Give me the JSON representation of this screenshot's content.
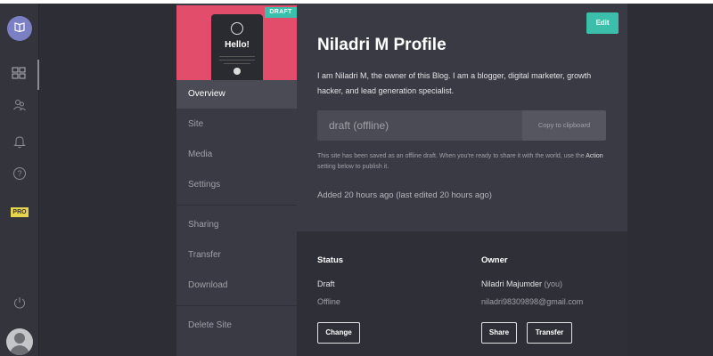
{
  "thumbnail": {
    "greeting": "Hello!",
    "badge": "DRAFT"
  },
  "nav": {
    "items": [
      "Overview",
      "Site",
      "Media",
      "Settings",
      "Sharing",
      "Transfer",
      "Download",
      "Delete Site"
    ]
  },
  "rail": {
    "pro_label": "PRO"
  },
  "site": {
    "title": "Niladri M Profile",
    "description": "I am Niladri M, the owner of this Blog. I am a blogger, digital marketer, growth hacker, and lead generation specialist.",
    "url": "draft (offline)",
    "copy_label": "Copy to clipboard",
    "note_before": "This site has been saved as an offline draft. When you're ready to share it with the world, use the",
    "note_action": "Action",
    "note_after": "setting below to publish it.",
    "added": "Added 20 hours ago (last edited 20 hours ago)",
    "edit_label": "Edit"
  },
  "status": {
    "heading": "Status",
    "value": "Draft",
    "sub": "Offline",
    "change_label": "Change"
  },
  "owner": {
    "heading": "Owner",
    "name": "Niladri Majumder",
    "you": "(you)",
    "email": "niladri98309898@gmail.com",
    "share_label": "Share",
    "transfer_label": "Transfer"
  },
  "colors": {
    "accent": "#3bbfab",
    "thumbnail": "#e24d6b",
    "pro_badge": "#e8d44d",
    "logo": "#7b7fc4"
  }
}
